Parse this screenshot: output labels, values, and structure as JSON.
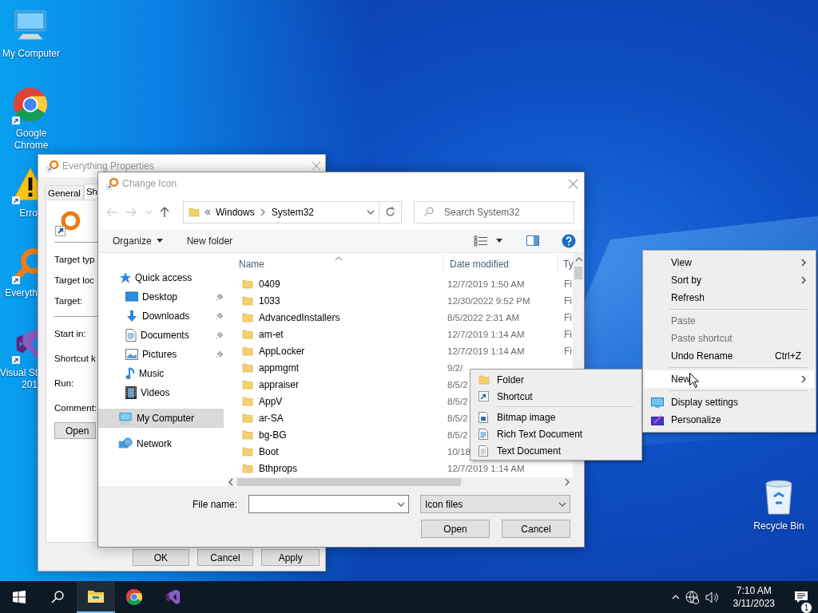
{
  "desktop_icons": [
    {
      "kind": "computer",
      "lines": [
        "My Computer"
      ],
      "clipped": false
    },
    {
      "kind": "chrome",
      "lines": [
        "Google",
        "Chrome"
      ],
      "clipped": false
    },
    {
      "kind": "warning",
      "lines": [
        "Erro"
      ],
      "clipped": true
    },
    {
      "kind": "everything",
      "lines": [
        "Everyth"
      ],
      "clipped": true
    },
    {
      "kind": "studio",
      "lines": [
        "Visual St",
        "201"
      ],
      "clipped": true
    }
  ],
  "recycle_bin": {
    "label": "Recycle Bin"
  },
  "properties_dialog": {
    "title": "Everything Properties",
    "tabs": [
      {
        "label": "General",
        "selected": false
      },
      {
        "label": "Sh",
        "selected": true
      }
    ],
    "fields": [
      "Target typ",
      "Target loc",
      "Target:",
      "Start in:",
      "Shortcut k",
      "Run:",
      "Comment:"
    ],
    "open_button": "Open",
    "buttons": [
      "OK",
      "Cancel",
      "Apply"
    ]
  },
  "file_dialog": {
    "title": "Change Icon",
    "breadcrumb": [
      "Windows",
      "System32"
    ],
    "search": {
      "placeholder": "Search System32"
    },
    "toolbar": [
      "Organize",
      "New folder"
    ],
    "nav": [
      {
        "label": "Quick access",
        "kind": "star",
        "pinned": false,
        "selected": false,
        "children": [
          {
            "label": "Desktop",
            "kind": "desktop",
            "pinned": true,
            "selected": false
          },
          {
            "label": "Downloads",
            "kind": "download",
            "pinned": true,
            "selected": false
          },
          {
            "label": "Documents",
            "kind": "document",
            "pinned": true,
            "selected": false
          },
          {
            "label": "Pictures",
            "kind": "picture",
            "pinned": true,
            "selected": false
          },
          {
            "label": "Music",
            "kind": "music",
            "pinned": false,
            "selected": false
          },
          {
            "label": "Videos",
            "kind": "video",
            "pinned": false,
            "selected": false
          }
        ]
      },
      {
        "label": "My Computer",
        "kind": "computer",
        "pinned": false,
        "selected": true
      },
      {
        "label": "Network",
        "kind": "network",
        "pinned": false,
        "selected": false
      }
    ],
    "columns": [
      "Name",
      "Date modified",
      "Ty"
    ],
    "rows": [
      {
        "name": "0409",
        "date": "12/7/2019 1:50 AM",
        "type": "Fi"
      },
      {
        "name": "1033",
        "date": "12/30/2022 9:52 PM",
        "type": "Fi"
      },
      {
        "name": "AdvancedInstallers",
        "date": "8/5/2022 2:31 AM",
        "type": "Fi"
      },
      {
        "name": "am-et",
        "date": "12/7/2019 1:14 AM",
        "type": "Fi"
      },
      {
        "name": "AppLocker",
        "date": "12/7/2019 1:14 AM",
        "type": "Fi"
      },
      {
        "name": "appmgmt",
        "date": "9/2/"
      },
      {
        "name": "appraiser",
        "date": "8/5/2"
      },
      {
        "name": "AppV",
        "date": "8/5/2"
      },
      {
        "name": "ar-SA",
        "date": "8/5/2"
      },
      {
        "name": "bg-BG",
        "date": "8/5/2"
      },
      {
        "name": "Boot",
        "date": "10/18"
      },
      {
        "name": "Bthprops",
        "date": "12/7/2019 1:14 AM"
      }
    ],
    "file_name": {
      "label": "File name:"
    },
    "file_type": "Icon files",
    "buttons": [
      "Open",
      "Cancel"
    ]
  },
  "context_menu": {
    "items": [
      {
        "kind": "item",
        "label": "View",
        "has_submenu": true,
        "disabled": false,
        "selected": false
      },
      {
        "kind": "item",
        "label": "Sort by",
        "has_submenu": true,
        "disabled": false,
        "selected": false
      },
      {
        "kind": "item",
        "label": "Refresh",
        "has_submenu": false,
        "disabled": false,
        "selected": false
      },
      {
        "kind": "separator"
      },
      {
        "kind": "item",
        "label": "Paste",
        "has_submenu": false,
        "disabled": true,
        "selected": false
      },
      {
        "kind": "item",
        "label": "Paste shortcut",
        "has_submenu": false,
        "disabled": true,
        "selected": false
      },
      {
        "kind": "item",
        "label": "Undo Rename",
        "shortcut": "Ctrl+Z",
        "has_submenu": false,
        "disabled": false,
        "selected": false
      },
      {
        "kind": "separator"
      },
      {
        "kind": "item",
        "label": "New",
        "has_submenu": true,
        "disabled": false,
        "selected": true
      },
      {
        "kind": "separator"
      },
      {
        "kind": "display",
        "label": "Display settings",
        "has_submenu": false,
        "disabled": false,
        "selected": false
      },
      {
        "kind": "personalize",
        "label": "Personalize",
        "has_submenu": false,
        "disabled": false,
        "selected": false
      }
    ]
  },
  "new_submenu": {
    "items": [
      {
        "kind": "folder",
        "label": "Folder"
      },
      {
        "kind": "shortcut",
        "label": "Shortcut"
      },
      {
        "kind": "separator"
      },
      {
        "kind": "bitmap",
        "label": "Bitmap image"
      },
      {
        "kind": "rtf",
        "label": "Rich Text Document"
      },
      {
        "kind": "text",
        "label": "Text Document"
      }
    ]
  },
  "taskbar": {
    "apps": [
      {
        "kind": "explorer",
        "selected": true
      },
      {
        "kind": "chrome",
        "selected": false
      },
      {
        "kind": "studio",
        "selected": false
      }
    ],
    "time": "7:10 AM",
    "date": "3/11/2023",
    "notifications": "1"
  }
}
